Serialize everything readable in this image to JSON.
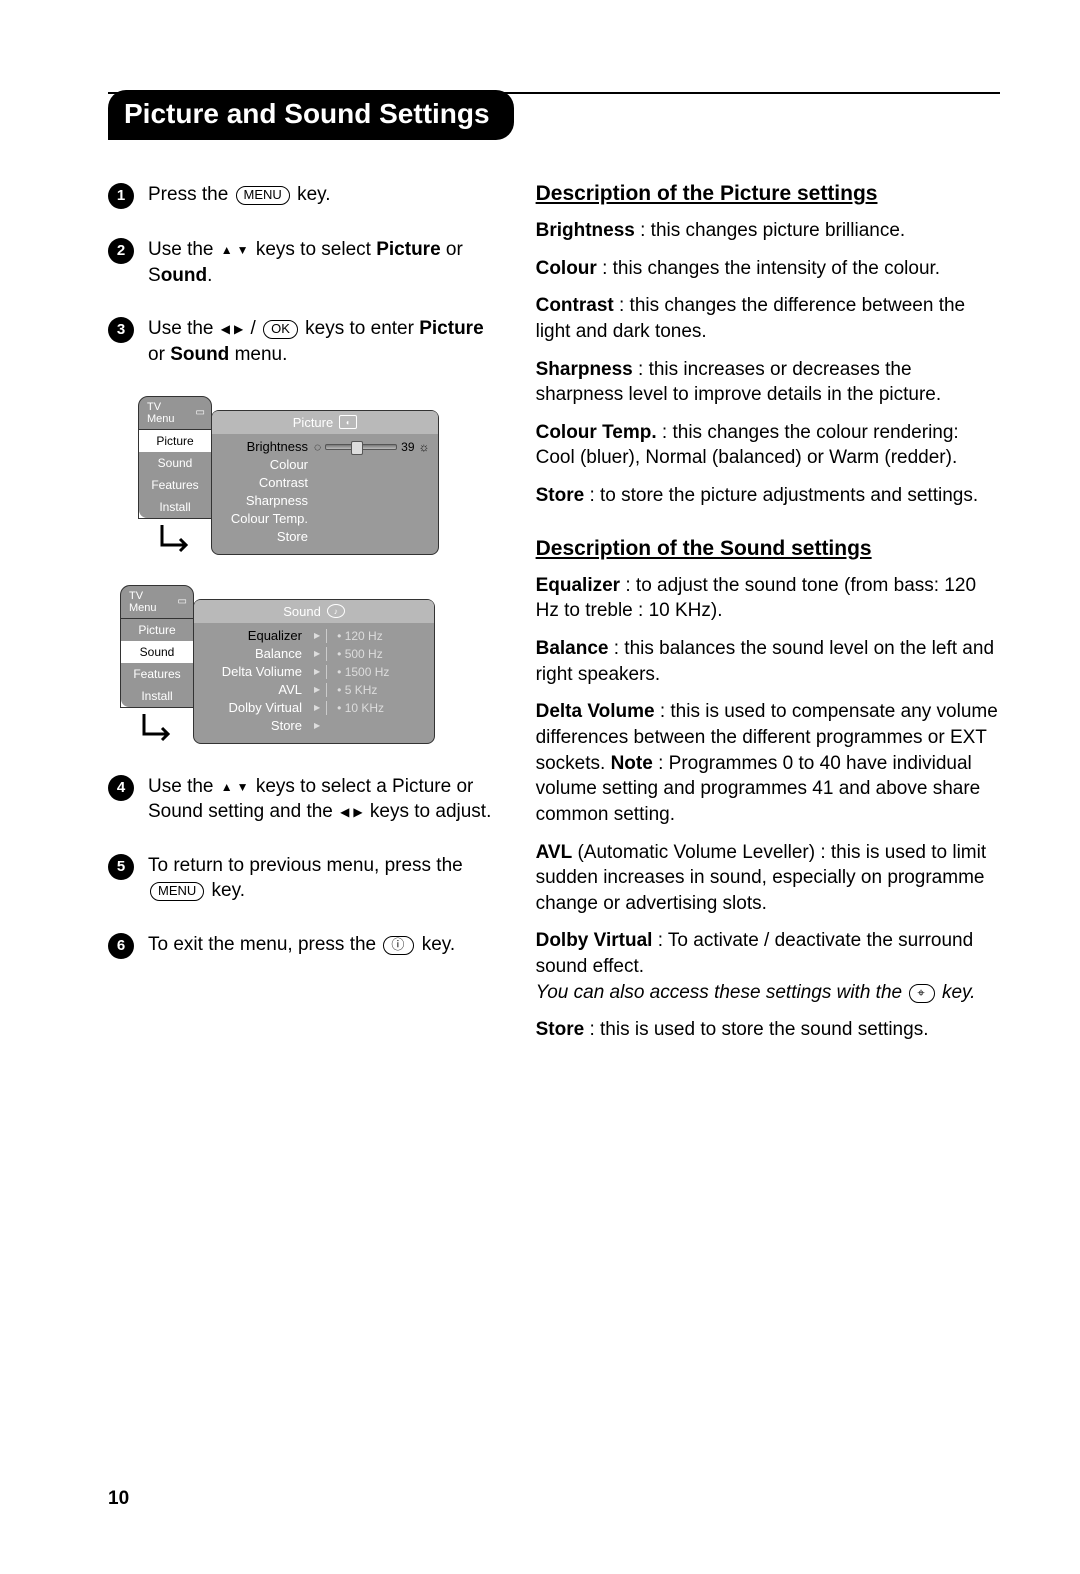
{
  "title": "Picture and Sound Settings",
  "page_number": "10",
  "keys": {
    "menu": "MENU",
    "ok": "OK"
  },
  "steps": {
    "s1": {
      "pre": "Press the ",
      "post": " key."
    },
    "s2": {
      "pre": "Use the ",
      "mid": " keys to select ",
      "bold1": "Picture",
      "or": " or S",
      "bold2": "ound",
      "post": "."
    },
    "s3": {
      "pre": "Use the ",
      "slash": " / ",
      "post": " keys to enter ",
      "bold1": "Picture",
      "or": " or ",
      "bold2": "Sound",
      "end": " menu."
    },
    "s4": {
      "pre": "Use the ",
      "mid": " keys to select a Picture or Sound setting and the ",
      "post": " keys to adjust."
    },
    "s5": {
      "pre": "To return to previous menu, press the ",
      "post": " key."
    },
    "s6": {
      "pre": "To exit the menu, press the ",
      "post": " key."
    }
  },
  "osd1": {
    "tab": "TV Menu",
    "cats": [
      "Picture",
      "Sound",
      "Features",
      "Install"
    ],
    "active_cat": 0,
    "head": "Picture",
    "rows": [
      "Brightness",
      "Colour",
      "Contrast",
      "Sharpness",
      "Colour Temp.",
      "Store"
    ],
    "active_row": 0,
    "brightness_value": "39"
  },
  "osd2": {
    "tab": "TV Menu",
    "cats": [
      "Picture",
      "Sound",
      "Features",
      "Install"
    ],
    "active_cat": 1,
    "head": "Sound",
    "rows": [
      "Equalizer",
      "Balance",
      "Delta Voliume",
      "AVL",
      "Dolby Virtual",
      "Store"
    ],
    "active_row": 0,
    "freq": [
      "120 Hz",
      "500 Hz",
      "1500 Hz",
      "5 KHz",
      "10 KHz"
    ]
  },
  "picture_heading": "Description of the Picture settings",
  "picture_desc": {
    "brightness": {
      "b": "Brightness",
      "t": " : this changes picture brilliance."
    },
    "colour": {
      "b": "Colour",
      "t": " : this changes the intensity of the colour."
    },
    "contrast": {
      "b": "Contrast",
      "t": " : this changes the difference between the light and dark tones."
    },
    "sharpness": {
      "b": "Sharpness",
      "t": " : this increases or decreases the sharpness level to improve details in the picture."
    },
    "colour_temp": {
      "b": "Colour Temp.",
      "t": " : this changes the colour rendering: Cool (bluer), Normal (balanced) or Warm (redder)."
    },
    "store": {
      "b": "Store",
      "t": " : to store the picture adjustments and settings."
    }
  },
  "sound_heading": "Description of the Sound settings",
  "sound_desc": {
    "equalizer": {
      "b": "Equalizer",
      "t": " : to adjust the sound tone (from bass: 120 Hz to treble : 10 KHz)."
    },
    "balance": {
      "b": "Balance",
      "t": " : this balances the sound level on the left and right speakers."
    },
    "delta": {
      "b": "Delta Volume",
      "t": " : this is used to compensate any volume differences between the different programmes or EXT sockets. ",
      "noteb": "Note",
      "notet": " : Programmes 0 to 40 have individual volume setting and programmes 41 and above share common setting."
    },
    "avl": {
      "b": "AVL",
      "t2": " (Automatic Volume Leveller) : this is used to limit sudden increases in sound, especially on programme change or advertising slots."
    },
    "dolby": {
      "b": "Dolby Virtual",
      "t": " : To activate / deactivate the surround sound effect.",
      "italic": "You can also access these settings with the ",
      "italic2": " key."
    },
    "store": {
      "b": "Store",
      "t": " : this is used to store the sound settings."
    }
  }
}
